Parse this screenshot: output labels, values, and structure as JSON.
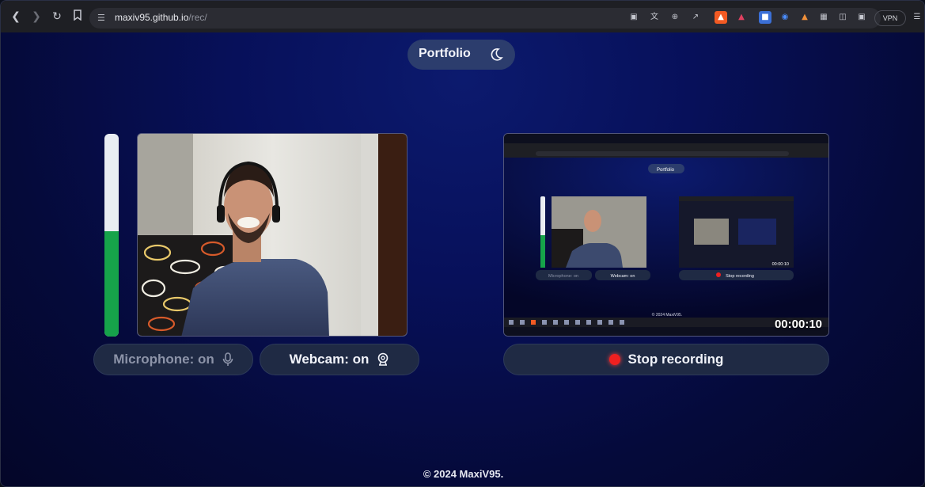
{
  "browser": {
    "url_host": "maxiv95.github.io",
    "url_path": "/rec/",
    "vpn_label": "VPN"
  },
  "header": {
    "portfolio_label": "Portfolio",
    "theme_icon": "moon-icon"
  },
  "recorder": {
    "mic_level": 0.52,
    "microphone_label": "Microphone: on",
    "microphone_icon": "microphone-icon",
    "webcam_label": "Webcam: on",
    "webcam_icon": "webcam-icon",
    "stop_label": "Stop recording",
    "timer": "00:00:10"
  },
  "screen_preview": {
    "portfolio_label": "Portfolio",
    "microphone_label": "Microphone: on",
    "webcam_label": "Webcam: on",
    "stop_label": "Stop recording",
    "footer": "© 2024 MaxiV95.",
    "timer": "00:00:10"
  },
  "colors": {
    "accent_green": "#16a34a",
    "record_red": "#ef2020",
    "page_bg": "#06082e"
  },
  "footer": {
    "copyright": "© 2024 MaxiV95."
  }
}
